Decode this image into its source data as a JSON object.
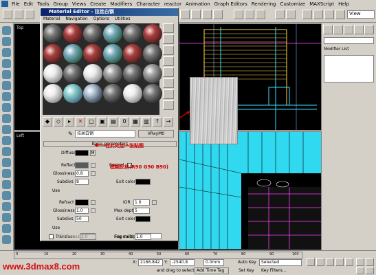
{
  "menu": [
    "File",
    "Edit",
    "Tools",
    "Group",
    "Views",
    "Create",
    "Modifiers",
    "Character",
    "reactor",
    "Animation",
    "Graph Editors",
    "Rendering",
    "Customize",
    "MAXScript",
    "Help"
  ],
  "toolbar": {
    "view_label": "View"
  },
  "viewports": {
    "top_label": "Top",
    "left_label": "Left"
  },
  "command_panel": {
    "modifier_list": "Modifier List"
  },
  "material_editor": {
    "title": "Material Editor - 拉丝白钢",
    "menu": [
      "Material",
      "Navigation",
      "Options",
      "Utilities"
    ],
    "material_name": "拉丝白钢",
    "material_type": "VRayMtl",
    "rollout_title": "Basic parameters",
    "diffuse_label": "Diffuse",
    "diffuse_map_btn": "M",
    "reflect_label": "Reflect",
    "fresnel_label": "Fresnel",
    "glossiness_label": "Glossiness",
    "glossiness_value": "0.8",
    "subdivs_label": "Subdivs",
    "subdivs_value": "8",
    "exit_color_label": "Exit color",
    "use_label": "Use",
    "refract_label": "Refract",
    "ior_label": "IOR",
    "ior_value": "1.6",
    "refr_glossiness_value": "1.0",
    "max_depth_label": "Max depth",
    "max_depth_value": "5",
    "refr_subdivs_value": "50",
    "refr_exit_color_label": "Exit color",
    "refr_use_label": "Use",
    "translucent_label": "Transluce",
    "fog_color_label": "Fog color",
    "thickness_label": "Thickness",
    "thickness_value": "2.0",
    "fog_multiplier_label": "Fog multiplier",
    "fog_multiplier_value": "1.0"
  },
  "annotations": {
    "diffuse_note": "在此处加一张贴图",
    "reflect_note": "模糊反射(R90 G90 B90)"
  },
  "status": {
    "x_label": "X:",
    "x_value": "2166.842",
    "y_label": "Y:",
    "y_value": "-2540.8",
    "z_value": "0.0mm",
    "prompt": "and drag to select",
    "add_time_tag": "Add Time Tag",
    "auto_key": "Auto Key",
    "selected": "Selected",
    "set_key": "Set Key",
    "key_filters": "Key Filters...",
    "ticks": [
      "0",
      "10",
      "20",
      "30",
      "40",
      "50",
      "60",
      "70",
      "80",
      "90",
      "100"
    ]
  },
  "watermark": "www.3dmax8.com",
  "colors": {
    "accent_red": "#cc0000",
    "watermark_red": "#d41010",
    "title_blue": "#0a246a"
  }
}
